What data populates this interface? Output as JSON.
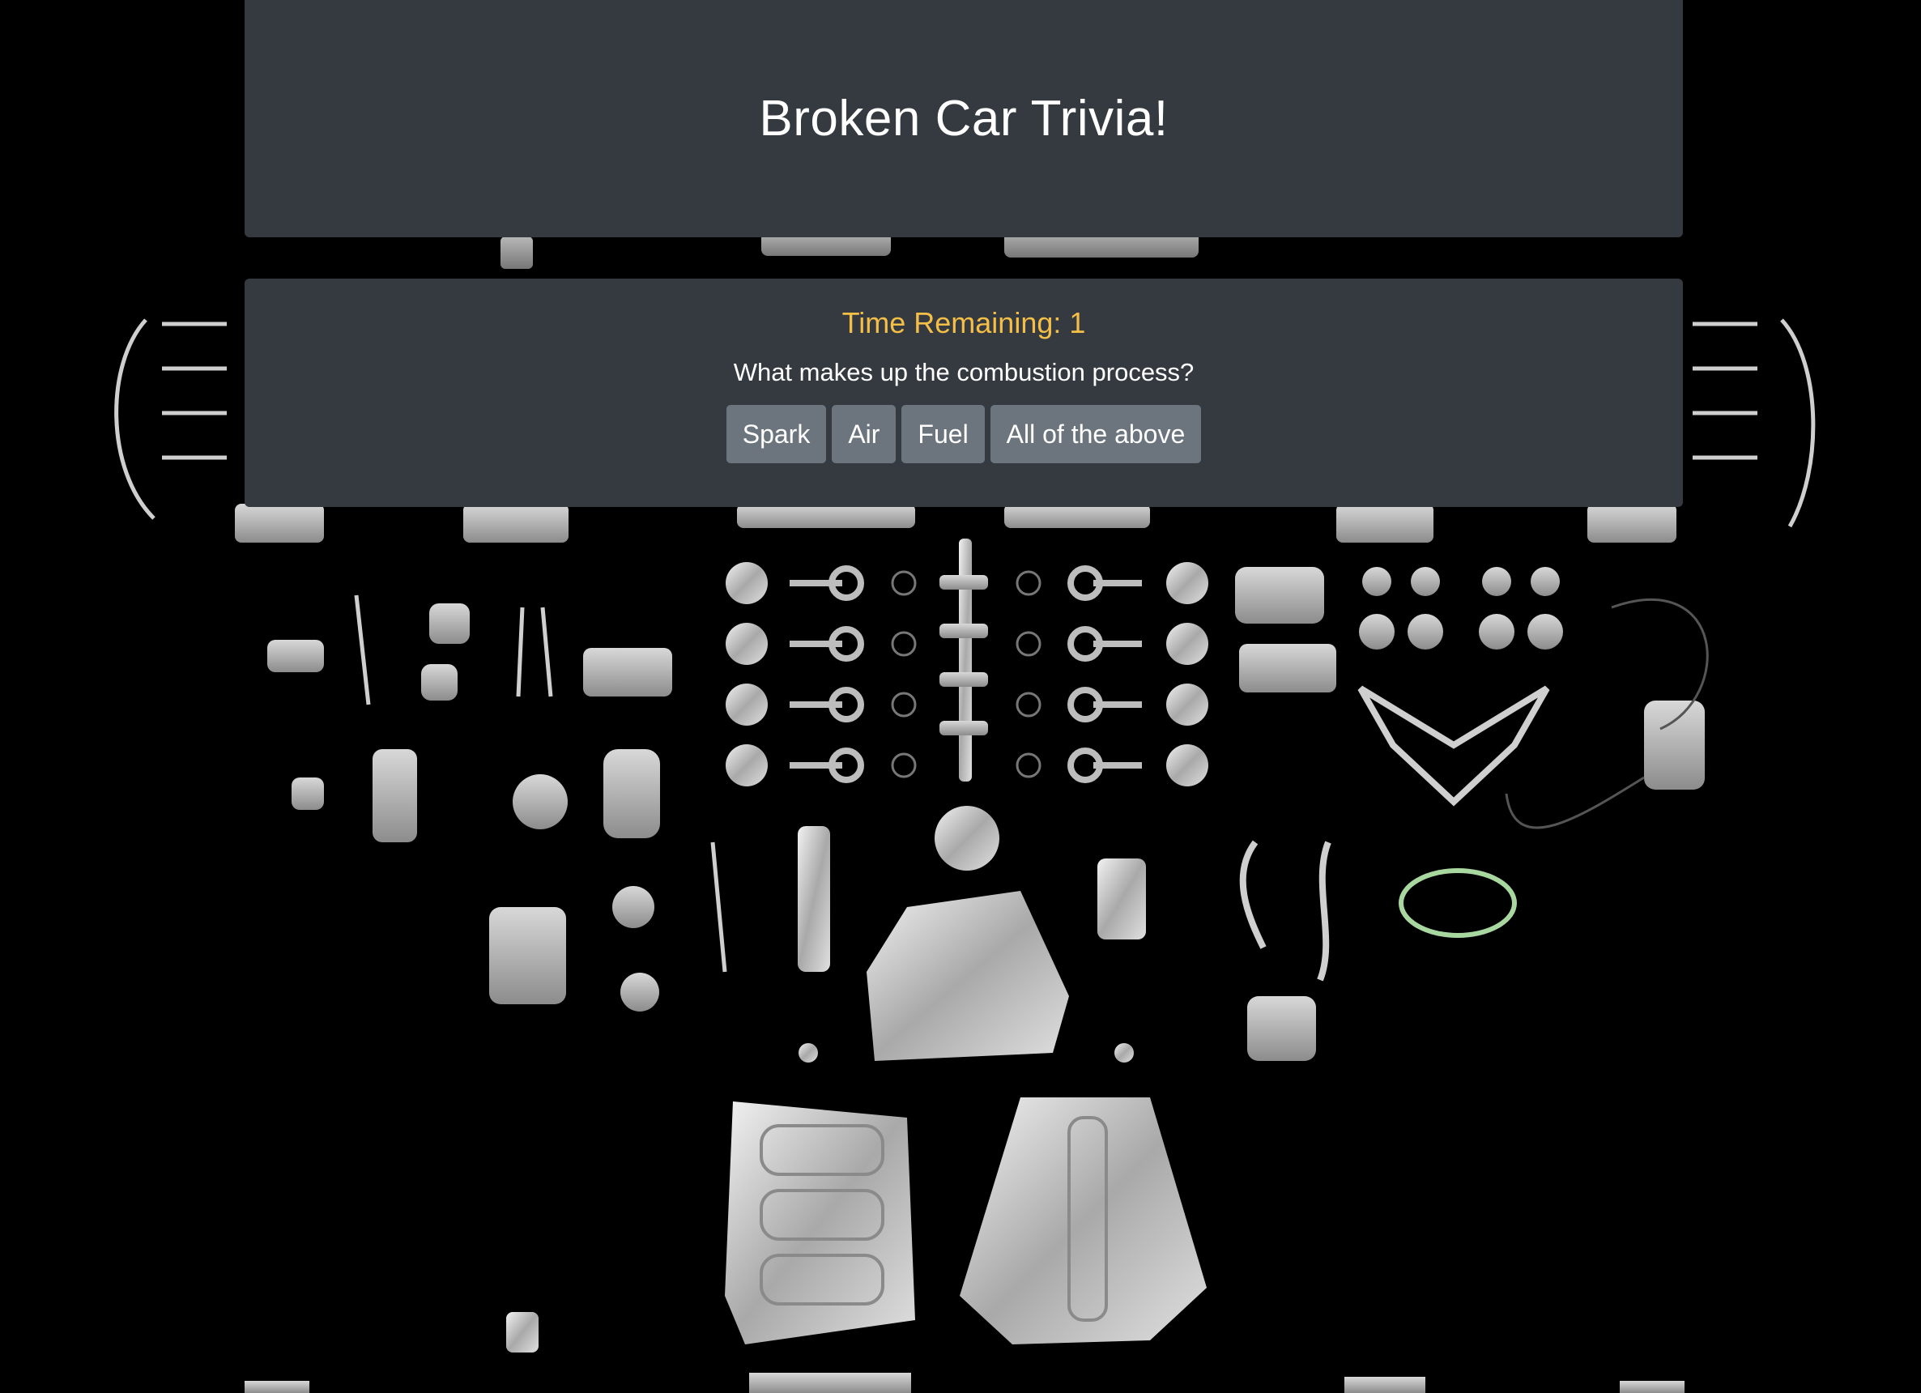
{
  "header": {
    "title": "Broken Car Trivia!"
  },
  "quiz": {
    "timer_text": "Time Remaining: 1",
    "question": "What makes up the combustion process?",
    "answers": [
      "Spark",
      "Air",
      "Fuel",
      "All of the above"
    ]
  },
  "colors": {
    "background": "#000000",
    "panel": "#343a40",
    "timer": "#f4be47",
    "button": "#6c757d",
    "text": "#ffffff"
  },
  "background_image": {
    "icon": "engine-parts-exploded-view"
  }
}
